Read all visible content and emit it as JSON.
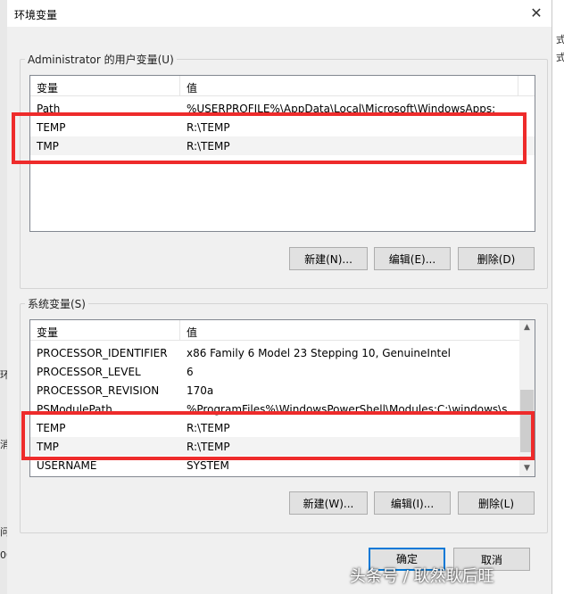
{
  "background_left_fragments": [
    "环",
    "消",
    "问",
    "00"
  ],
  "background_right_fragments": [
    "式",
    "式"
  ],
  "title": "环境变量",
  "user_section": {
    "label": "Administrator 的用户变量(U)",
    "header": {
      "variable": "变量",
      "value": "值"
    },
    "rows": [
      {
        "variable": "Path",
        "value": "%USERPROFILE%\\AppData\\Local\\Microsoft\\WindowsApps;"
      },
      {
        "variable": "TEMP",
        "value": "R:\\TEMP"
      },
      {
        "variable": "TMP",
        "value": "R:\\TEMP"
      }
    ],
    "buttons": {
      "new": "新建(N)...",
      "edit": "编辑(E)...",
      "delete": "删除(D)"
    }
  },
  "system_section": {
    "label": "系统变量(S)",
    "header": {
      "variable": "变量",
      "value": "值"
    },
    "rows": [
      {
        "variable": "PROCESSOR_IDENTIFIER",
        "value": "x86 Family 6 Model 23 Stepping 10, GenuineIntel"
      },
      {
        "variable": "PROCESSOR_LEVEL",
        "value": "6"
      },
      {
        "variable": "PROCESSOR_REVISION",
        "value": "170a"
      },
      {
        "variable": "PSModulePath",
        "value": "%ProgramFiles%\\WindowsPowerShell\\Modules;C:\\windows\\s..."
      },
      {
        "variable": "TEMP",
        "value": "R:\\TEMP"
      },
      {
        "variable": "TMP",
        "value": "R:\\TEMP"
      },
      {
        "variable": "USERNAME",
        "value": "SYSTEM"
      }
    ],
    "buttons": {
      "new": "新建(W)...",
      "edit": "编辑(I)...",
      "delete": "删除(L)"
    }
  },
  "footer": {
    "ok": "确定",
    "cancel": "取消"
  },
  "watermark": "头条号 / 耿然耿后旺",
  "colors": {
    "highlight": "#ee2b2b",
    "accent": "#0078d7"
  }
}
